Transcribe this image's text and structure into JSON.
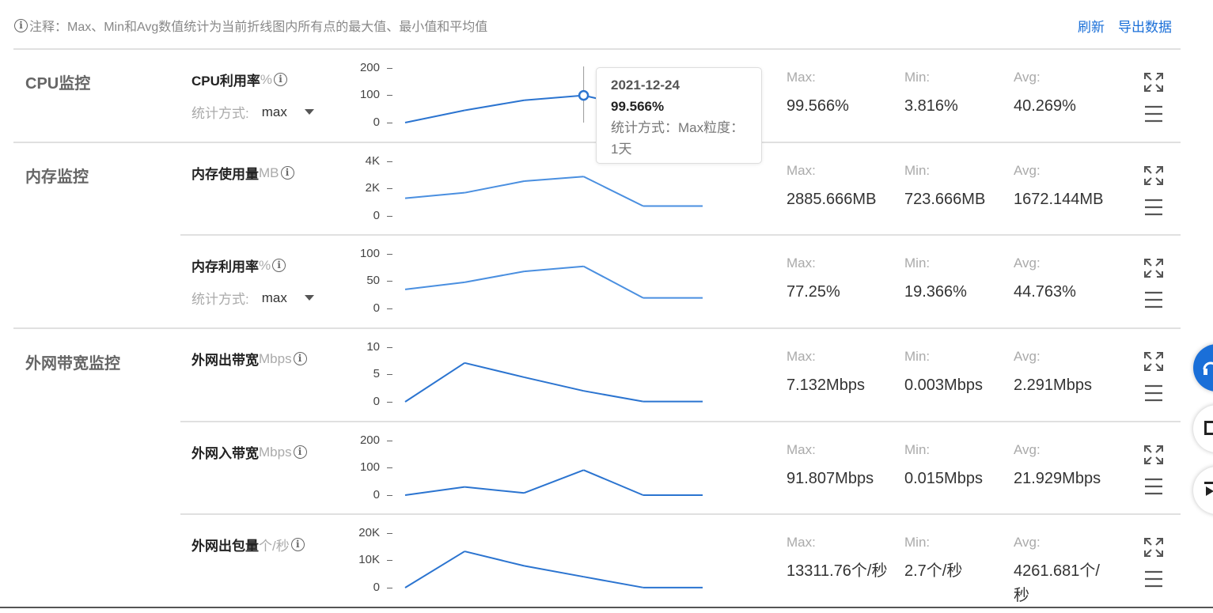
{
  "header": {
    "note": "注释：Max、Min和Avg数值统计为当前折线图内所有点的最大值、最小值和平均值",
    "refresh": "刷新",
    "export": "导出数据"
  },
  "groups": {
    "cpu": "CPU监控",
    "memory": "内存监控",
    "bandwidth": "外网带宽监控"
  },
  "summary_labels": {
    "max": "Max:",
    "min": "Min:",
    "avg": "Avg:"
  },
  "stat_mode_label": "统计方式:",
  "metrics": [
    {
      "name": "CPU利用率",
      "unit": "%",
      "has_stat": true,
      "stat_value": "max",
      "yticks": [
        "200",
        "100",
        "0"
      ],
      "ymax": 200,
      "values": [
        0,
        45,
        82,
        99.566,
        50,
        50
      ],
      "max": "99.566%",
      "min": "3.816%",
      "avg": "40.269%"
    },
    {
      "name": "内存使用量",
      "unit": "MB",
      "has_stat": false,
      "yticks": [
        "4K",
        "2K",
        "0"
      ],
      "ymax": 4000,
      "values": [
        1300,
        1700,
        2550,
        2885.666,
        723.666,
        723.666
      ],
      "max": "2885.666MB",
      "min": "723.666MB",
      "avg": "1672.144MB"
    },
    {
      "name": "内存利用率",
      "unit": "%",
      "has_stat": true,
      "stat_value": "max",
      "yticks": [
        "100",
        "50",
        "0"
      ],
      "ymax": 100,
      "values": [
        35,
        48,
        68,
        77.25,
        19.366,
        19.366
      ],
      "max": "77.25%",
      "min": "19.366%",
      "avg": "44.763%"
    },
    {
      "name": "外网出带宽",
      "unit": "Mbps",
      "has_stat": false,
      "yticks": [
        "10",
        "5",
        "0"
      ],
      "ymax": 10,
      "values": [
        0.003,
        7.132,
        4.5,
        2.0,
        0.05,
        0.05
      ],
      "max": "7.132Mbps",
      "min": "0.003Mbps",
      "avg": "2.291Mbps"
    },
    {
      "name": "外网入带宽",
      "unit": "Mbps",
      "has_stat": false,
      "yticks": [
        "200",
        "100",
        "0"
      ],
      "ymax": 200,
      "values": [
        0.015,
        30,
        8,
        91.807,
        0.02,
        0.02
      ],
      "max": "91.807Mbps",
      "min": "0.015Mbps",
      "avg": "21.929Mbps"
    },
    {
      "name": "外网出包量",
      "unit": "个/秒",
      "has_stat": false,
      "yticks": [
        "20K",
        "10K",
        "0"
      ],
      "ymax": 20000,
      "values": [
        2.7,
        13311.76,
        8000,
        4000,
        50,
        50
      ],
      "max": "13311.76个/秒",
      "min": "2.7个/秒",
      "avg": "4261.681个/秒"
    }
  ],
  "tooltip": {
    "date": "2021-12-24",
    "value": "99.566%",
    "desc": "统计方式：Max粒度：1天"
  },
  "colors": {
    "line": "#2b74d0",
    "link": "#1a6fd8"
  }
}
